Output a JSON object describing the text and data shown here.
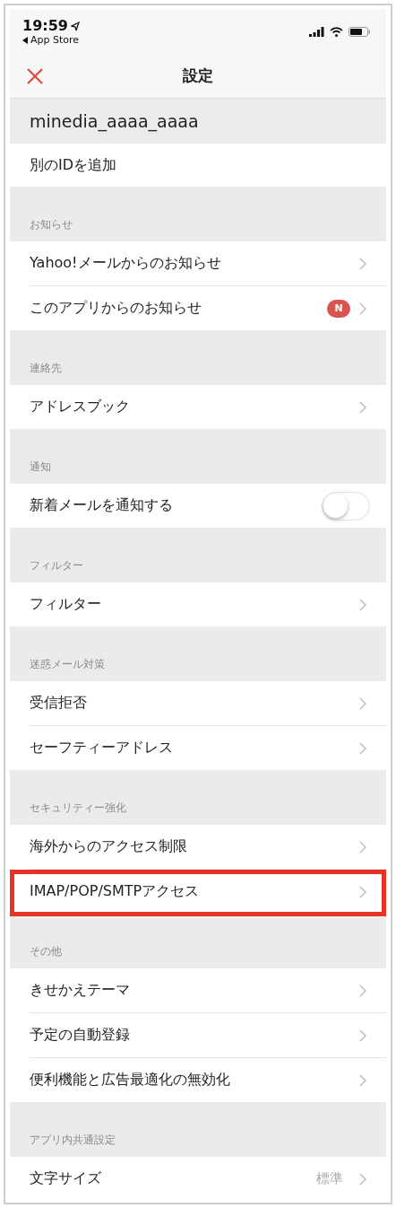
{
  "status_bar": {
    "time": "19:59",
    "back_label": "App Store"
  },
  "nav": {
    "title": "設定"
  },
  "account": {
    "name": "minedia_aaaa_aaaa"
  },
  "add_id": {
    "label": "別のIDを追加"
  },
  "sections": [
    {
      "header": "お知らせ",
      "rows": [
        {
          "kind": "link",
          "label": "Yahoo!メールからのお知らせ",
          "highlighted": false
        },
        {
          "kind": "badge",
          "label": "このアプリからのお知らせ",
          "badge": "N",
          "highlighted": false
        }
      ]
    },
    {
      "header": "連絡先",
      "rows": [
        {
          "kind": "link",
          "label": "アドレスブック",
          "highlighted": false
        }
      ]
    },
    {
      "header": "通知",
      "rows": [
        {
          "kind": "toggle",
          "label": "新着メールを通知する",
          "on": false,
          "highlighted": false
        }
      ]
    },
    {
      "header": "フィルター",
      "rows": [
        {
          "kind": "link",
          "label": "フィルター",
          "highlighted": false
        }
      ]
    },
    {
      "header": "迷惑メール対策",
      "rows": [
        {
          "kind": "link",
          "label": "受信拒否",
          "highlighted": false
        },
        {
          "kind": "link",
          "label": "セーフティーアドレス",
          "highlighted": false
        }
      ]
    },
    {
      "header": "セキュリティー強化",
      "rows": [
        {
          "kind": "link",
          "label": "海外からのアクセス制限",
          "highlighted": false
        },
        {
          "kind": "link",
          "label": "IMAP/POP/SMTPアクセス",
          "highlighted": true
        }
      ]
    },
    {
      "header": "その他",
      "rows": [
        {
          "kind": "link",
          "label": "きせかえテーマ",
          "highlighted": false
        },
        {
          "kind": "link",
          "label": "予定の自動登録",
          "highlighted": false
        },
        {
          "kind": "link",
          "label": "便利機能と広告最適化の無効化",
          "highlighted": false
        }
      ]
    },
    {
      "header": "アプリ内共通設定",
      "rows": [
        {
          "kind": "value",
          "label": "文字サイズ",
          "value": "標準",
          "highlighted": false
        }
      ]
    }
  ]
}
